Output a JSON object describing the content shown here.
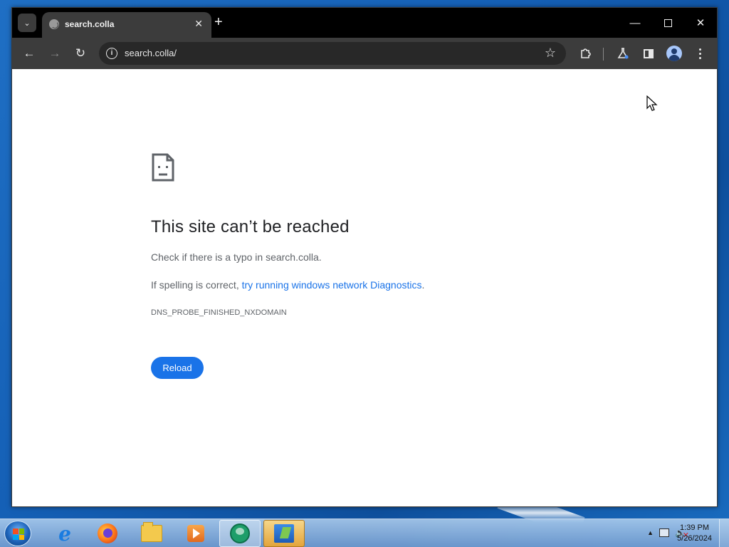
{
  "browser": {
    "tab": {
      "title": "search.colla"
    },
    "address_bar": {
      "url": "search.colla/"
    }
  },
  "error_page": {
    "title": "This site can’t be reached",
    "line1": "Check if there is a typo in search.colla.",
    "line2_prefix": "If spelling is correct, ",
    "line2_link": "try running windows network Diagnostics",
    "line2_suffix": ".",
    "error_code": "DNS_PROBE_FINISHED_NXDOMAIN",
    "reload_label": "Reload"
  },
  "taskbar": {
    "apps": [
      {
        "name": "internet-explorer-icon"
      },
      {
        "name": "firefox-icon"
      },
      {
        "name": "file-explorer-icon"
      },
      {
        "name": "media-player-icon"
      },
      {
        "name": "chrome-icon"
      },
      {
        "name": "active-app-icon"
      }
    ],
    "clock": {
      "time": "1:39 PM",
      "date": "5/26/2024"
    }
  },
  "colors": {
    "link": "#1a73e8",
    "reload_button": "#1a73e8",
    "title_text": "#202124",
    "body_text": "#5f6368",
    "browser_toolbar": "#3c3c3c",
    "browser_titlebar": "#000000"
  }
}
